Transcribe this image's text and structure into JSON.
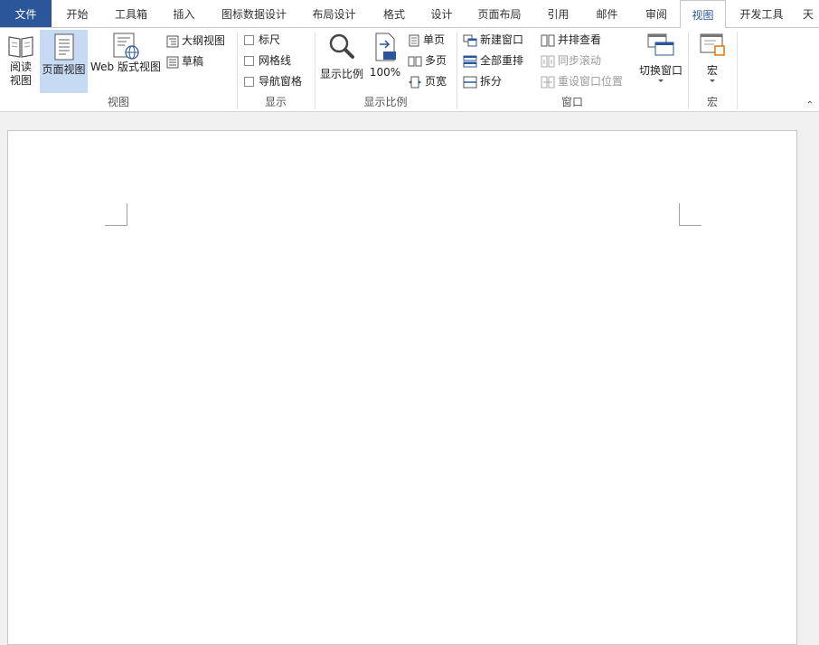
{
  "tabs": [
    {
      "label": "文件",
      "kind": "file"
    },
    {
      "label": "开始"
    },
    {
      "label": "工具箱"
    },
    {
      "label": "插入"
    },
    {
      "label": "图标数据设计"
    },
    {
      "label": "布局设计"
    },
    {
      "label": "格式"
    },
    {
      "label": "设计"
    },
    {
      "label": "页面布局"
    },
    {
      "label": "引用"
    },
    {
      "label": "邮件"
    },
    {
      "label": "审阅"
    },
    {
      "label": "视图",
      "active": true
    },
    {
      "label": "开发工具"
    },
    {
      "label": "天"
    }
  ],
  "groups": {
    "views": {
      "label": "视图",
      "read_mode": "阅读\n视图",
      "print_layout": "页面视图",
      "web_layout": "Web 版式视图",
      "outline": "大纲视图",
      "draft": "草稿"
    },
    "show": {
      "label": "显示",
      "ruler": "标尺",
      "gridlines": "网格线",
      "nav_pane": "导航窗格"
    },
    "zoom": {
      "label": "显示比例",
      "zoom": "显示比例",
      "hundred": "100%",
      "one_page": "单页",
      "multi_page": "多页",
      "page_width": "页宽"
    },
    "window": {
      "label": "窗口",
      "new_window": "新建窗口",
      "arrange_all": "全部重排",
      "split": "拆分",
      "side_by_side": "并排查看",
      "sync_scroll": "同步滚动",
      "reset_position": "重设窗口位置",
      "switch_windows": "切换窗口"
    },
    "macros": {
      "label": "宏",
      "macros": "宏"
    }
  },
  "colors": {
    "file_tab": "#2b579a",
    "accent": "#2b579a",
    "selected": "#c7daf4"
  }
}
